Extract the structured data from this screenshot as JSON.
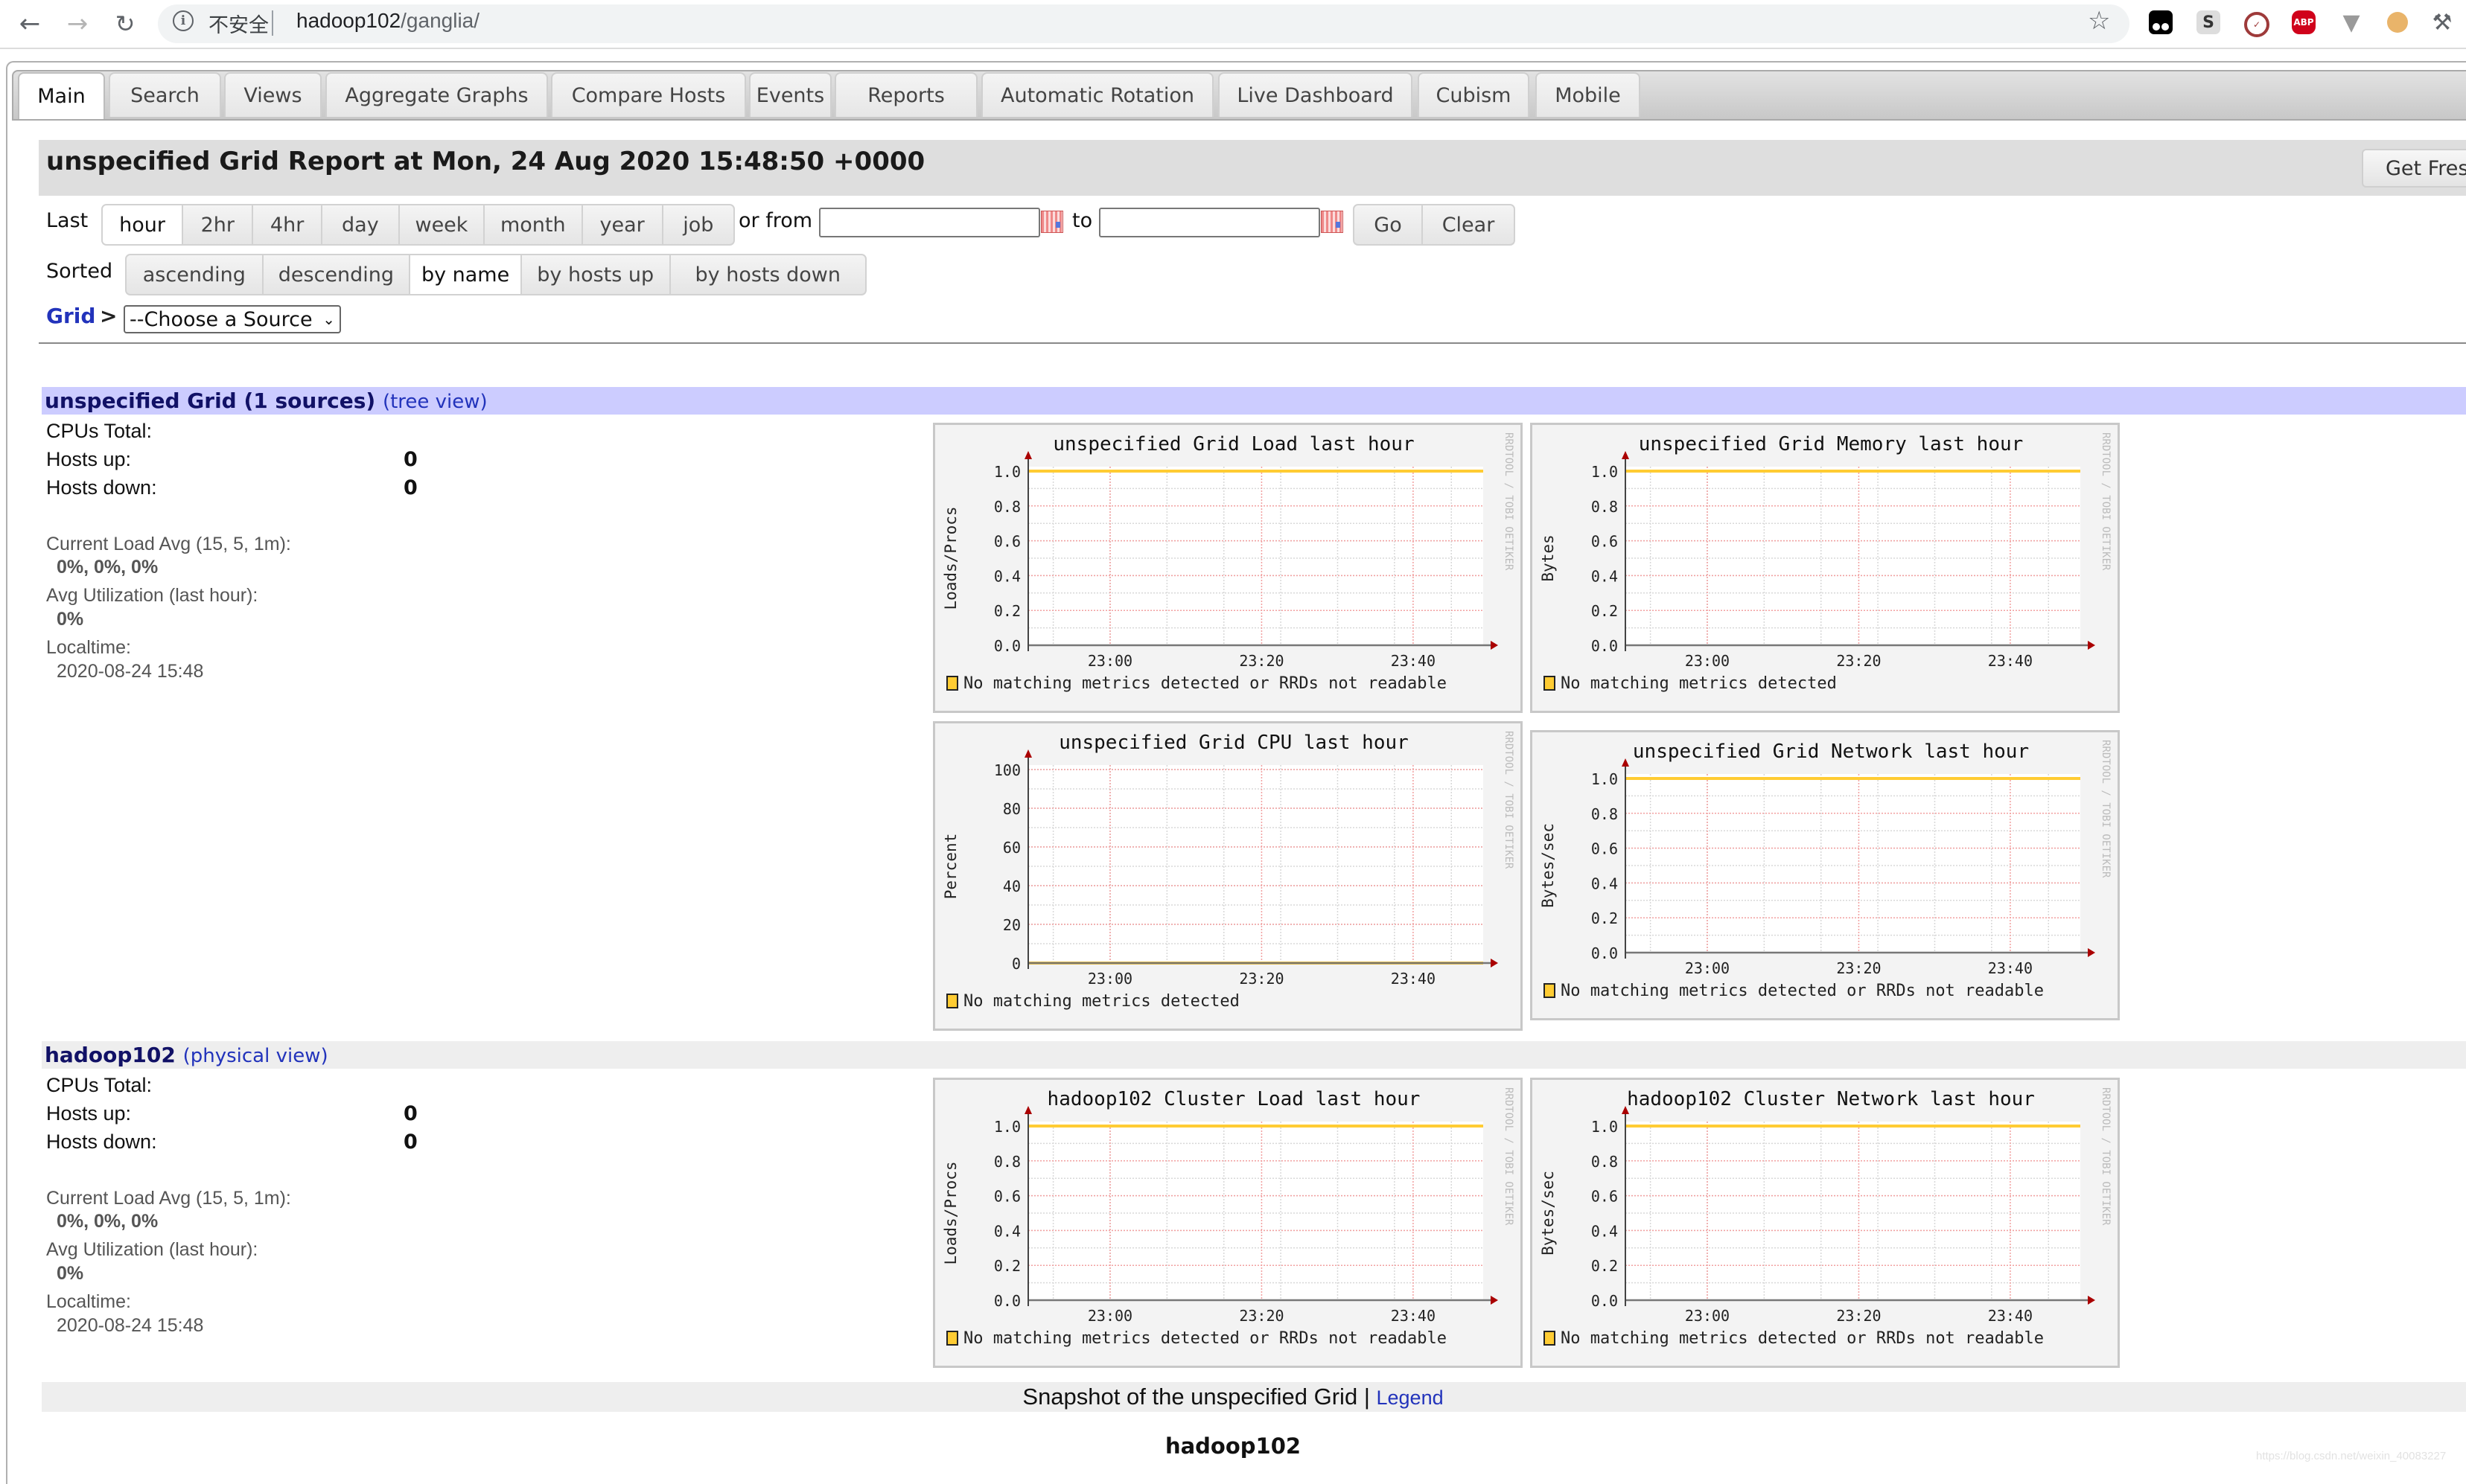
{
  "browser": {
    "security_label": "不安全",
    "url_host": "hadoop102",
    "url_path": "/ganglia/",
    "extensions": [
      "tampermonkey-icon",
      "s-extension-icon",
      "clock-extension-icon",
      "adblock-plus-icon",
      "vue-devtools-icon",
      "cookie-icon",
      "extensions-puzzle-icon"
    ],
    "abp_label": "ABP",
    "s_label": "S"
  },
  "tabs": [
    {
      "label": "Main",
      "active": true
    },
    {
      "label": "Search"
    },
    {
      "label": "Views"
    },
    {
      "label": "Aggregate Graphs"
    },
    {
      "label": "Compare Hosts"
    },
    {
      "label": "Events"
    },
    {
      "label": "Reports"
    },
    {
      "label": "Automatic Rotation"
    },
    {
      "label": "Live Dashboard"
    },
    {
      "label": "Cubism"
    },
    {
      "label": "Mobile"
    }
  ],
  "header": {
    "title": "unspecified Grid Report at Mon, 24 Aug 2020 15:48:50 +0000",
    "fresh_button": "Get Fres"
  },
  "range": {
    "label": "Last",
    "options": [
      "hour",
      "2hr",
      "4hr",
      "day",
      "week",
      "month",
      "year",
      "job"
    ],
    "selected": "hour",
    "from_label": "or from",
    "from_value": "",
    "to_label": "to",
    "to_value": "",
    "go": "Go",
    "clear": "Clear"
  },
  "sort": {
    "label": "Sorted",
    "options": [
      "ascending",
      "descending",
      "by name",
      "by hosts up",
      "by hosts down"
    ],
    "selected": "by name"
  },
  "breadcrumb": {
    "grid": "Grid",
    "sep": ">",
    "source_select": "--Choose a Source"
  },
  "sections": [
    {
      "title": "unspecified Grid (1 sources)",
      "link": "(tree view)",
      "cpus_total_label": "CPUs Total:",
      "cpus_total": "",
      "hosts_up_label": "Hosts up:",
      "hosts_up": "0",
      "hosts_down_label": "Hosts down:",
      "hosts_down": "0",
      "load_avg_label": "Current Load Avg (15, 5, 1m):",
      "load_avg": "0%, 0%, 0%",
      "util_label": "Avg Utilization (last hour):",
      "util": "0%",
      "localtime_label": "Localtime:",
      "localtime": "2020-08-24 15:48"
    },
    {
      "title": "hadoop102",
      "link": "(physical view)",
      "cpus_total_label": "CPUs Total:",
      "cpus_total": "",
      "hosts_up_label": "Hosts up:",
      "hosts_up": "0",
      "hosts_down_label": "Hosts down:",
      "hosts_down": "0",
      "load_avg_label": "Current Load Avg (15, 5, 1m):",
      "load_avg": "0%, 0%, 0%",
      "util_label": "Avg Utilization (last hour):",
      "util": "0%",
      "localtime_label": "Localtime:",
      "localtime": "2020-08-24 15:48"
    }
  ],
  "chart_data": [
    {
      "id": "grid-load",
      "type": "line",
      "title": "unspecified Grid Load last hour",
      "ylabel": "Loads/Procs",
      "xlabel": "",
      "x_ticks": [
        "23:00",
        "23:20",
        "23:40"
      ],
      "y_ticks": [
        "0.0",
        "0.2",
        "0.4",
        "0.6",
        "0.8",
        "1.0"
      ],
      "ylim": [
        0,
        1
      ],
      "series": [
        {
          "name": "No matching metrics detected or RRDs not readable",
          "color": "#ffcc33",
          "values": [
            1.0,
            1.0
          ]
        }
      ],
      "legend": "bottom-left",
      "watermark": "RRDTOOL / TOBI OETIKER",
      "grid": true
    },
    {
      "id": "grid-memory",
      "type": "line",
      "title": "unspecified Grid Memory last hour",
      "ylabel": "Bytes",
      "xlabel": "",
      "x_ticks": [
        "23:00",
        "23:20",
        "23:40"
      ],
      "y_ticks": [
        "0.0",
        "0.2",
        "0.4",
        "0.6",
        "0.8",
        "1.0"
      ],
      "ylim": [
        0,
        1
      ],
      "series": [
        {
          "name": "No matching metrics detected",
          "color": "#ffcc33",
          "values": [
            1.0,
            1.0
          ]
        }
      ],
      "legend": "bottom-left",
      "watermark": "RRDTOOL / TOBI OETIKER",
      "grid": true
    },
    {
      "id": "grid-cpu",
      "type": "line",
      "title": "unspecified Grid CPU last hour",
      "ylabel": "Percent",
      "xlabel": "",
      "x_ticks": [
        "23:00",
        "23:20",
        "23:40"
      ],
      "y_ticks": [
        "0",
        "20",
        "40",
        "60",
        "80",
        "100"
      ],
      "ylim": [
        0,
        100
      ],
      "series": [
        {
          "name": "No matching metrics detected",
          "color": "#ffcc33",
          "values": [
            0,
            0
          ]
        }
      ],
      "legend": "bottom-left",
      "watermark": "RRDTOOL / TOBI OETIKER",
      "grid": true
    },
    {
      "id": "grid-network",
      "type": "line",
      "title": "unspecified Grid Network last hour",
      "ylabel": "Bytes/sec",
      "xlabel": "",
      "x_ticks": [
        "23:00",
        "23:20",
        "23:40"
      ],
      "y_ticks": [
        "0.0",
        "0.2",
        "0.4",
        "0.6",
        "0.8",
        "1.0"
      ],
      "ylim": [
        0,
        1
      ],
      "series": [
        {
          "name": "No matching metrics detected or RRDs not readable",
          "color": "#ffcc33",
          "values": [
            1.0,
            1.0
          ]
        }
      ],
      "legend": "bottom-left",
      "watermark": "RRDTOOL / TOBI OETIKER",
      "grid": true
    },
    {
      "id": "cluster-load",
      "type": "line",
      "title": "hadoop102 Cluster Load last hour",
      "ylabel": "Loads/Procs",
      "xlabel": "",
      "x_ticks": [
        "23:00",
        "23:20",
        "23:40"
      ],
      "y_ticks": [
        "0.0",
        "0.2",
        "0.4",
        "0.6",
        "0.8",
        "1.0"
      ],
      "ylim": [
        0,
        1
      ],
      "series": [
        {
          "name": "No matching metrics detected or RRDs not readable",
          "color": "#ffcc33",
          "values": [
            1.0,
            1.0
          ]
        }
      ],
      "legend": "bottom-left",
      "watermark": "RRDTOOL / TOBI OETIKER",
      "grid": true
    },
    {
      "id": "cluster-network",
      "type": "line",
      "title": "hadoop102 Cluster Network last hour",
      "ylabel": "Bytes/sec",
      "xlabel": "",
      "x_ticks": [
        "23:00",
        "23:20",
        "23:40"
      ],
      "y_ticks": [
        "0.0",
        "0.2",
        "0.4",
        "0.6",
        "0.8",
        "1.0"
      ],
      "ylim": [
        0,
        1
      ],
      "series": [
        {
          "name": "No matching metrics detected or RRDs not readable",
          "color": "#ffcc33",
          "values": [
            1.0,
            1.0
          ]
        }
      ],
      "legend": "bottom-left",
      "watermark": "RRDTOOL / TOBI OETIKER",
      "grid": true
    }
  ],
  "footer": {
    "snapshot_text": "Snapshot of the unspecified Grid",
    "separator": "|",
    "legend_link": "Legend",
    "host": "hadoop102",
    "watermark": "https://blog.csdn.net/weixin_40083227"
  }
}
